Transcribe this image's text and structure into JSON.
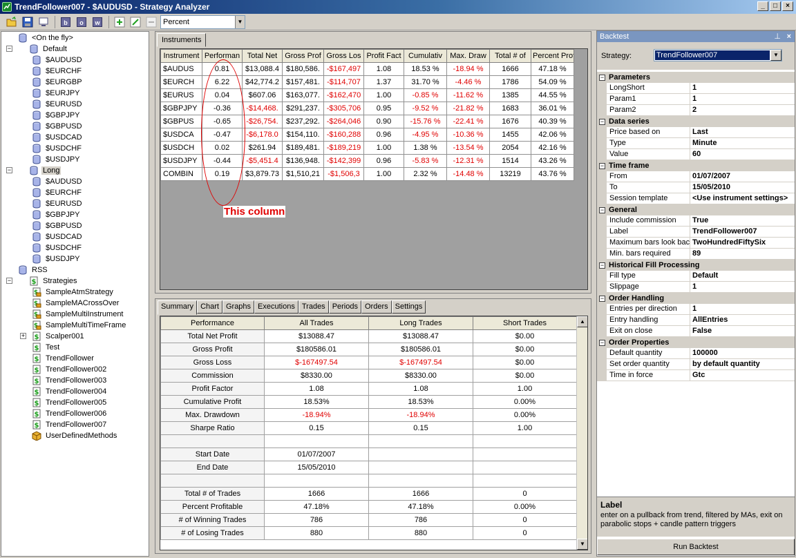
{
  "window": {
    "title": "TrendFollower007 - $AUDUSD - Strategy Analyzer",
    "minimize": "_",
    "restore": "□",
    "close": "×"
  },
  "toolbar": {
    "letters": [
      "b",
      "o",
      "w"
    ],
    "display_combo": "Percent"
  },
  "tree": [
    {
      "label": "<On the fly>",
      "icon": "db",
      "level": 1
    },
    {
      "label": "Default",
      "icon": "db",
      "level": 0,
      "expander": "−"
    },
    {
      "label": "$AUDUSD",
      "icon": "db",
      "level": 2
    },
    {
      "label": "$EURCHF",
      "icon": "db",
      "level": 2
    },
    {
      "label": "$EURGBP",
      "icon": "db",
      "level": 2
    },
    {
      "label": "$EURJPY",
      "icon": "db",
      "level": 2
    },
    {
      "label": "$EURUSD",
      "icon": "db",
      "level": 2
    },
    {
      "label": "$GBPJPY",
      "icon": "db",
      "level": 2
    },
    {
      "label": "$GBPUSD",
      "icon": "db",
      "level": 2
    },
    {
      "label": "$USDCAD",
      "icon": "db",
      "level": 2
    },
    {
      "label": "$USDCHF",
      "icon": "db",
      "level": 2
    },
    {
      "label": "$USDJPY",
      "icon": "db",
      "level": 2
    },
    {
      "label": "Long",
      "icon": "db",
      "level": 0,
      "expander": "−",
      "selected": true
    },
    {
      "label": "$AUDUSD",
      "icon": "db",
      "level": 2
    },
    {
      "label": "$EURCHF",
      "icon": "db",
      "level": 2
    },
    {
      "label": "$EURUSD",
      "icon": "db",
      "level": 2
    },
    {
      "label": "$GBPJPY",
      "icon": "db",
      "level": 2
    },
    {
      "label": "$GBPUSD",
      "icon": "db",
      "level": 2
    },
    {
      "label": "$USDCAD",
      "icon": "db",
      "level": 2
    },
    {
      "label": "$USDCHF",
      "icon": "db",
      "level": 2
    },
    {
      "label": "$USDJPY",
      "icon": "db",
      "level": 2
    },
    {
      "label": "RSS",
      "icon": "db",
      "level": 1
    },
    {
      "label": "Strategies",
      "icon": "script",
      "level": 0,
      "expander": "−"
    },
    {
      "label": "SampleAtmStrategy",
      "icon": "lock",
      "level": 2
    },
    {
      "label": "SampleMACrossOver",
      "icon": "lock",
      "level": 2
    },
    {
      "label": "SampleMultiInstrument",
      "icon": "lock",
      "level": 2
    },
    {
      "label": "SampleMultiTimeFrame",
      "icon": "lock",
      "level": 2
    },
    {
      "label": "Scalper001",
      "icon": "script",
      "level": 2,
      "expander": "+"
    },
    {
      "label": "Test",
      "icon": "script",
      "level": 2
    },
    {
      "label": "TrendFollower",
      "icon": "script",
      "level": 2
    },
    {
      "label": "TrendFollower002",
      "icon": "script",
      "level": 2
    },
    {
      "label": "TrendFollower003",
      "icon": "script",
      "level": 2
    },
    {
      "label": "TrendFollower004",
      "icon": "script",
      "level": 2
    },
    {
      "label": "TrendFollower005",
      "icon": "script",
      "level": 2
    },
    {
      "label": "TrendFollower006",
      "icon": "script",
      "level": 2
    },
    {
      "label": "TrendFollower007",
      "icon": "script",
      "level": 2
    },
    {
      "label": "UserDefinedMethods",
      "icon": "box",
      "level": 2
    }
  ],
  "instruments": {
    "tab_label": "Instruments",
    "columns": [
      "Instrument",
      "Performan",
      "Total Net",
      "Gross Prof",
      "Gross Los",
      "Profit Fact",
      "Cumulativ",
      "Max. Draw",
      "Total # of",
      "Percent Prof"
    ],
    "rows": [
      [
        "$AUDUS",
        "0.81",
        "$13,088.4",
        "$180,586.",
        "-$167,497",
        "1.08",
        "18.53 %",
        "-18.94 %",
        "1666",
        "47.18 %"
      ],
      [
        "$EURCH",
        "6.22",
        "$42,774.2",
        "$157,481.",
        "-$114,707",
        "1.37",
        "31.70 %",
        "-4.46 %",
        "1786",
        "54.09 %"
      ],
      [
        "$EURUS",
        "0.04",
        "$607.06",
        "$163,077.",
        "-$162,470",
        "1.00",
        "-0.85 %",
        "-11.62 %",
        "1385",
        "44.55 %"
      ],
      [
        "$GBPJPY",
        "-0.36",
        "-$14,468.",
        "$291,237.",
        "-$305,706",
        "0.95",
        "-9.52 %",
        "-21.82 %",
        "1683",
        "36.01 %"
      ],
      [
        "$GBPUS",
        "-0.65",
        "-$26,754.",
        "$237,292.",
        "-$264,046",
        "0.90",
        "-15.76 %",
        "-22.41 %",
        "1676",
        "40.39 %"
      ],
      [
        "$USDCA",
        "-0.47",
        "-$6,178.0",
        "$154,110.",
        "-$160,288",
        "0.96",
        "-4.95 %",
        "-10.36 %",
        "1455",
        "42.06 %"
      ],
      [
        "$USDCH",
        "0.02",
        "$261.94",
        "$189,481.",
        "-$189,219",
        "1.00",
        "1.38 %",
        "-13.54 %",
        "2054",
        "42.16 %"
      ],
      [
        "$USDJPY",
        "-0.44",
        "-$5,451.4",
        "$136,948.",
        "-$142,399",
        "0.96",
        "-5.83 %",
        "-12.31 %",
        "1514",
        "43.26 %"
      ],
      [
        "COMBIN",
        "0.19",
        "$3,879.73",
        "$1,510,21",
        "-$1,506,3",
        "1.00",
        "2.32 %",
        "-14.48 %",
        "13219",
        "43.76 %"
      ]
    ],
    "annotation": "This column"
  },
  "summary": {
    "tabs": [
      "Summary",
      "Chart",
      "Graphs",
      "Executions",
      "Trades",
      "Periods",
      "Orders",
      "Settings"
    ],
    "columns": [
      "Performance",
      "All Trades",
      "Long Trades",
      "Short Trades"
    ],
    "rows": [
      [
        "Total Net Profit",
        "$13088.47",
        "$13088.47",
        "$0.00"
      ],
      [
        "Gross Profit",
        "$180586.01",
        "$180586.01",
        "$0.00"
      ],
      [
        "Gross Loss",
        "$-167497.54",
        "$-167497.54",
        "$0.00"
      ],
      [
        "Commission",
        "$8330.00",
        "$8330.00",
        "$0.00"
      ],
      [
        "Profit Factor",
        "1.08",
        "1.08",
        "1.00"
      ],
      [
        "Cumulative Profit",
        "18.53%",
        "18.53%",
        "0.00%"
      ],
      [
        "Max. Drawdown",
        "-18.94%",
        "-18.94%",
        "0.00%"
      ],
      [
        "Sharpe Ratio",
        "0.15",
        "0.15",
        "1.00"
      ],
      [
        "",
        "",
        "",
        ""
      ],
      [
        "Start Date",
        "01/07/2007",
        "",
        ""
      ],
      [
        "End Date",
        "15/05/2010",
        "",
        ""
      ],
      [
        "",
        "",
        "",
        ""
      ],
      [
        "Total # of Trades",
        "1666",
        "1666",
        "0"
      ],
      [
        "Percent Profitable",
        "47.18%",
        "47.18%",
        "0.00%"
      ],
      [
        "# of Winning Trades",
        "786",
        "786",
        "0"
      ],
      [
        "# of Losing Trades",
        "880",
        "880",
        "0"
      ]
    ]
  },
  "backtest": {
    "title": "Backtest",
    "pin": "⊥",
    "close": "×",
    "strategy_label": "Strategy:",
    "strategy_value": "TrendFollower007",
    "categories": [
      {
        "name": "Parameters",
        "rows": [
          [
            "LongShort",
            "1"
          ],
          [
            "Param1",
            "1"
          ],
          [
            "Param2",
            "2"
          ]
        ]
      },
      {
        "name": "Data series",
        "rows": [
          [
            "Price based on",
            "Last"
          ],
          [
            "Type",
            "Minute"
          ],
          [
            "Value",
            "60"
          ]
        ]
      },
      {
        "name": "Time frame",
        "rows": [
          [
            "From",
            "01/07/2007"
          ],
          [
            "To",
            "15/05/2010"
          ],
          [
            "Session template",
            "<Use instrument settings>"
          ]
        ]
      },
      {
        "name": "General",
        "rows": [
          [
            "Include commission",
            "True"
          ],
          [
            "Label",
            "TrendFollower007"
          ],
          [
            "Maximum bars look back",
            "TwoHundredFiftySix"
          ],
          [
            "Min. bars required",
            "89"
          ]
        ]
      },
      {
        "name": "Historical Fill Processing",
        "rows": [
          [
            "Fill type",
            "Default"
          ],
          [
            "Slippage",
            "1"
          ]
        ]
      },
      {
        "name": "Order Handling",
        "rows": [
          [
            "Entries per direction",
            "1"
          ],
          [
            "Entry handling",
            "AllEntries"
          ],
          [
            "Exit on close",
            "False"
          ]
        ]
      },
      {
        "name": "Order Properties",
        "rows": [
          [
            "Default quantity",
            "100000"
          ],
          [
            "Set order quantity",
            "by default quantity"
          ],
          [
            "Time in force",
            "Gtc"
          ]
        ]
      }
    ],
    "help_title": "Label",
    "help_text": "enter on a pullback from trend, filtered by MAs, exit on parabolic stops + candle pattern triggers",
    "run_button": "Run Backtest"
  },
  "colors": {
    "negative": "#e00000",
    "title_gradient_start": "#0a246a",
    "panel_header": "#7a96c0"
  }
}
